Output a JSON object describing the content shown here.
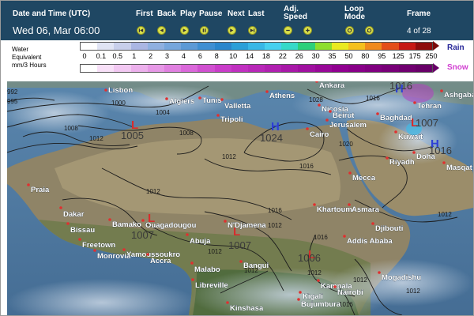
{
  "header": {
    "datetime_label": "Date and Time (UTC)",
    "datetime_value": "Wed 06, Mar 06:00",
    "controls": [
      {
        "id": "first",
        "label": "First",
        "icon": "skip-first-icon"
      },
      {
        "id": "back",
        "label": "Back",
        "icon": "step-back-icon"
      },
      {
        "id": "play",
        "label": "Play",
        "icon": "play-icon"
      },
      {
        "id": "pause",
        "label": "Pause",
        "icon": "pause-icon"
      },
      {
        "id": "next",
        "label": "Next",
        "icon": "step-forward-icon"
      },
      {
        "id": "last",
        "label": "Last",
        "icon": "skip-last-icon"
      }
    ],
    "speed_label_1": "Adj.",
    "speed_label_2": "Speed",
    "loop_label_1": "Loop",
    "loop_label_2": "Mode",
    "frame_label": "Frame",
    "frame_value": "4 of 28",
    "colors": {
      "bar": "#1f4763",
      "button": "#d9e04a"
    }
  },
  "legend": {
    "title_line1": "Water",
    "title_line2": "Equivalent",
    "title_line3": "mm/3 Hours",
    "ticks": [
      "0",
      "0.1",
      "0.5",
      "1",
      "2",
      "3",
      "4",
      "6",
      "8",
      "10",
      "14",
      "18",
      "22",
      "26",
      "30",
      "35",
      "50",
      "80",
      "95",
      "125",
      "175",
      "250"
    ],
    "rain_label": "Rain",
    "snow_label": "Snow",
    "rain_colors": [
      "#ffffff",
      "#e0e4f4",
      "#c8cfeb",
      "#aab6e3",
      "#8fb0e0",
      "#76a6dc",
      "#5c9ad6",
      "#3f8fd2",
      "#2a86cc",
      "#2b9fd8",
      "#38b7e6",
      "#47d0ef",
      "#36d9c9",
      "#2cd07a",
      "#8ede2c",
      "#eaea20",
      "#f5c01e",
      "#f08a1e",
      "#e44e1a",
      "#c61814",
      "#8e0c0c"
    ],
    "snow_colors": [
      "#ffffff",
      "#f8e0f8",
      "#f2c8f2",
      "#ecb0ec",
      "#e698e6",
      "#e080e0",
      "#da68da",
      "#d050d0",
      "#c93cc9",
      "#c030c0",
      "#b828b8",
      "#b020b0",
      "#a818a8",
      "#a010a0",
      "#980898",
      "#900090",
      "#880088",
      "#800080",
      "#780078",
      "#700070",
      "#680068"
    ]
  },
  "map": {
    "cities": [
      {
        "name": "Lisbon"
      },
      {
        "name": "Algiers"
      },
      {
        "name": "Tunis"
      },
      {
        "name": "Valletta"
      },
      {
        "name": "Tripoli"
      },
      {
        "name": "Athens"
      },
      {
        "name": "Ankara"
      },
      {
        "name": "Nicosia"
      },
      {
        "name": "Beirut"
      },
      {
        "name": "Jerusalem"
      },
      {
        "name": "Cairo"
      },
      {
        "name": "Baghdad"
      },
      {
        "name": "Tehran"
      },
      {
        "name": "Ashgabat"
      },
      {
        "name": "Kuwait"
      },
      {
        "name": "Riyadh"
      },
      {
        "name": "Doha"
      },
      {
        "name": "Masqat"
      },
      {
        "name": "Mecca"
      },
      {
        "name": "Khartoum"
      },
      {
        "name": "Asmara"
      },
      {
        "name": "Djibouti"
      },
      {
        "name": "Addis Ababa"
      },
      {
        "name": "Praia"
      },
      {
        "name": "Dakar"
      },
      {
        "name": "Bissau"
      },
      {
        "name": "Bamako"
      },
      {
        "name": "Ouagadougou"
      },
      {
        "name": "Freetown"
      },
      {
        "name": "Monrovia"
      },
      {
        "name": "Yamoussoukro"
      },
      {
        "name": "Accra"
      },
      {
        "name": "Abuja"
      },
      {
        "name": "N'Djamena"
      },
      {
        "name": "Malabo"
      },
      {
        "name": "Bangui"
      },
      {
        "name": "Libreville"
      },
      {
        "name": "Kampala"
      },
      {
        "name": "Nairobi"
      },
      {
        "name": "Kigali"
      },
      {
        "name": "Bujumbura"
      },
      {
        "name": "Kinshasa"
      },
      {
        "name": "Mogadishu"
      }
    ],
    "isobar_labels": [
      "992",
      "995",
      "1000",
      "1004",
      "1008",
      "1012",
      "1008",
      "1012",
      "1016",
      "1028",
      "1016",
      "1020",
      "1012",
      "1016",
      "1012",
      "1012",
      "1016",
      "1012",
      "1012",
      "1016",
      "1012",
      "1012",
      "1012"
    ],
    "pressure_centers": [
      {
        "type": "L",
        "value": "1005"
      },
      {
        "type": "H",
        "value": "1024"
      },
      {
        "type": "L",
        "value": "1007"
      },
      {
        "type": "L",
        "value": "1007"
      },
      {
        "type": "L",
        "value": "1006"
      },
      {
        "type": "H",
        "value": "1016"
      },
      {
        "type": "L",
        "value": "1007"
      },
      {
        "type": "H",
        "value": "1016"
      }
    ]
  }
}
